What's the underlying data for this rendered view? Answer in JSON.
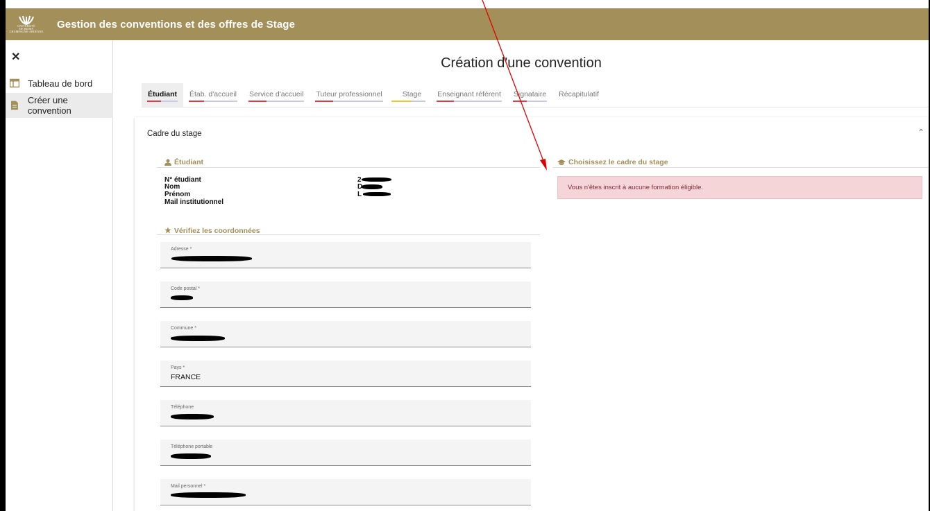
{
  "header": {
    "title": "Gestion des conventions et des offres de Stage",
    "logo_lines": [
      "UNIVERSITÉ",
      "DE REIMS",
      "CHAMPAGNE-ARDENNE"
    ]
  },
  "sidebar": {
    "close_glyph": "✕",
    "items": [
      {
        "label": "Tableau de bord",
        "icon": "dashboard-icon"
      },
      {
        "label": "Créer une convention",
        "icon": "document-icon",
        "active": true
      }
    ]
  },
  "page": {
    "title": "Création d'une convention"
  },
  "tabs": [
    {
      "label": "Étudiant",
      "active": true,
      "status_color": "#e53945"
    },
    {
      "label": "Étab. d'accueil",
      "status_color": "#e53945"
    },
    {
      "label": "Service d'accueil",
      "status_color": "#e53945"
    },
    {
      "label": "Tuteur professionnel",
      "status_color": "#e53945"
    },
    {
      "label": "Stage",
      "status_color": "#f2c531"
    },
    {
      "label": "Enseignant référent",
      "status_color": "#e53945"
    },
    {
      "label": "Signataire",
      "status_color": "#e53945"
    },
    {
      "label": "Récapitulatif",
      "status_color": ""
    }
  ],
  "panel": {
    "title": "Cadre du stage",
    "student_section": {
      "heading": "Étudiant",
      "labels": [
        "N° étudiant",
        "Nom",
        "Prénom",
        "Mail institutionnel"
      ],
      "value_prefixes": [
        "2",
        "D",
        "L",
        ""
      ]
    },
    "coords_section": {
      "heading": "Vérifiez les coordonnées",
      "fields": [
        {
          "label": "Adresse *",
          "value": ""
        },
        {
          "label": "Code postal *",
          "value": ""
        },
        {
          "label": "Commune *",
          "value": ""
        },
        {
          "label": "Pays *",
          "value": "FRANCE"
        },
        {
          "label": "Téléphone",
          "value": ""
        },
        {
          "label": "Téléphone portable",
          "value": ""
        },
        {
          "label": "Mail personnel *",
          "value": ""
        }
      ]
    },
    "frame_section": {
      "heading": "Choisissez le cadre du stage",
      "alert": "Vous n'êtes inscrit à aucune formation éligible."
    }
  },
  "colors": {
    "brand": "#a38f5a",
    "tab_track": "#c9c9e6",
    "alert_bg": "#f6d5d9",
    "annotation_arrow": "#e00000"
  }
}
